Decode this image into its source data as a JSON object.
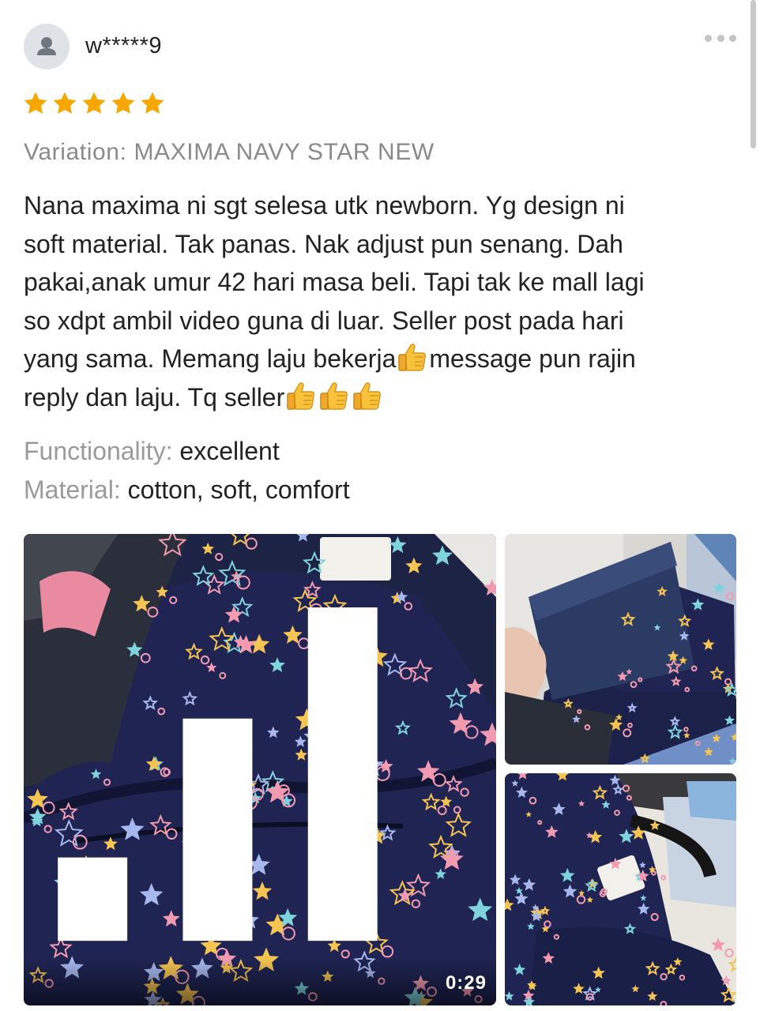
{
  "review": {
    "username": "w*****9",
    "rating": 5,
    "star_color": "#f6a700",
    "variation": "Variation: MAXIMA NAVY STAR NEW",
    "text_lines": [
      "Nana maxima ni sgt selesa utk newborn. Yg design ni",
      "soft material. Tak panas. Nak adjust pun senang. Dah",
      "pakai,anak umur 42 hari masa beli. Tapi tak ke mall lagi",
      "so xdpt ambil video guna di luar. Seller post pada hari",
      "yang sama. Memang laju bekerja",
      "message pun rajin",
      "reply dan laju. Tq seller"
    ],
    "emojis": [
      "thumbs-up-icon"
    ],
    "attributes": [
      {
        "key": "Functionality:",
        "value": " excellent"
      },
      {
        "key": "Material:",
        "value": " cotton, soft, comfort"
      }
    ]
  },
  "media": {
    "video": {
      "duration": "0:29",
      "icon": "video-bars-icon"
    },
    "photo_count": 2
  },
  "menu_icon": "more-dots-icon",
  "avatar_icon": "user-avatar-icon"
}
